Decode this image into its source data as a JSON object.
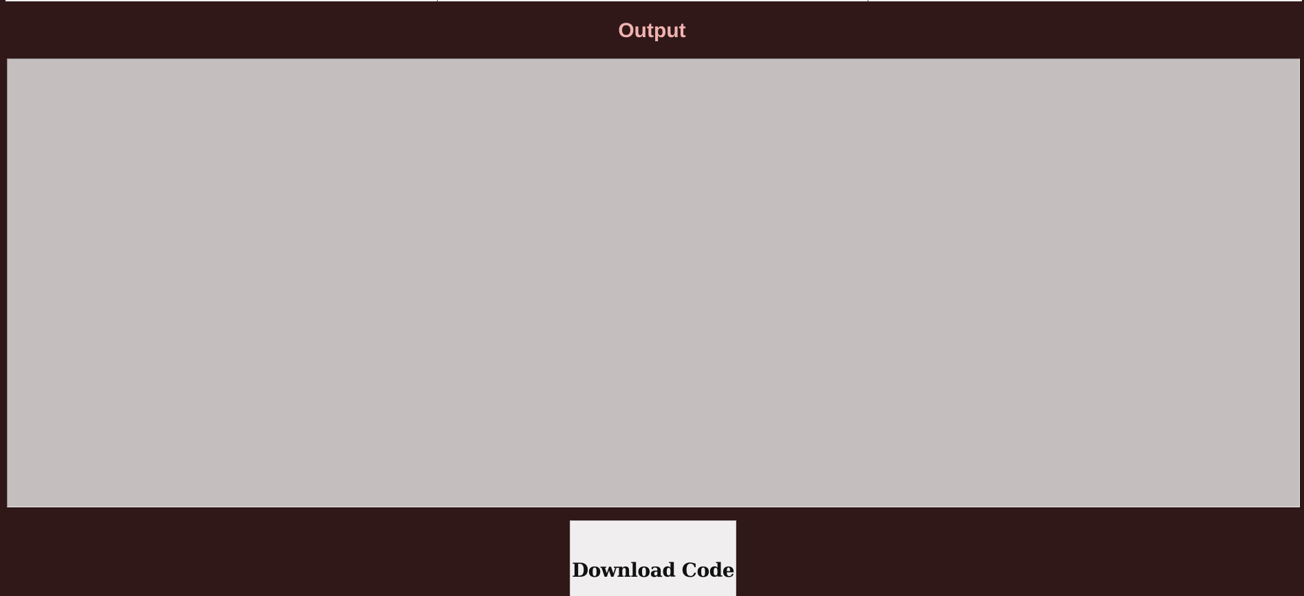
{
  "output": {
    "title": "Output",
    "value": ""
  },
  "actions": {
    "download_label": "Download Code"
  },
  "colors": {
    "background": "#301819",
    "title": "#f0b3b0",
    "output_panel": "#c4bebe",
    "button": "#f0eeee"
  }
}
